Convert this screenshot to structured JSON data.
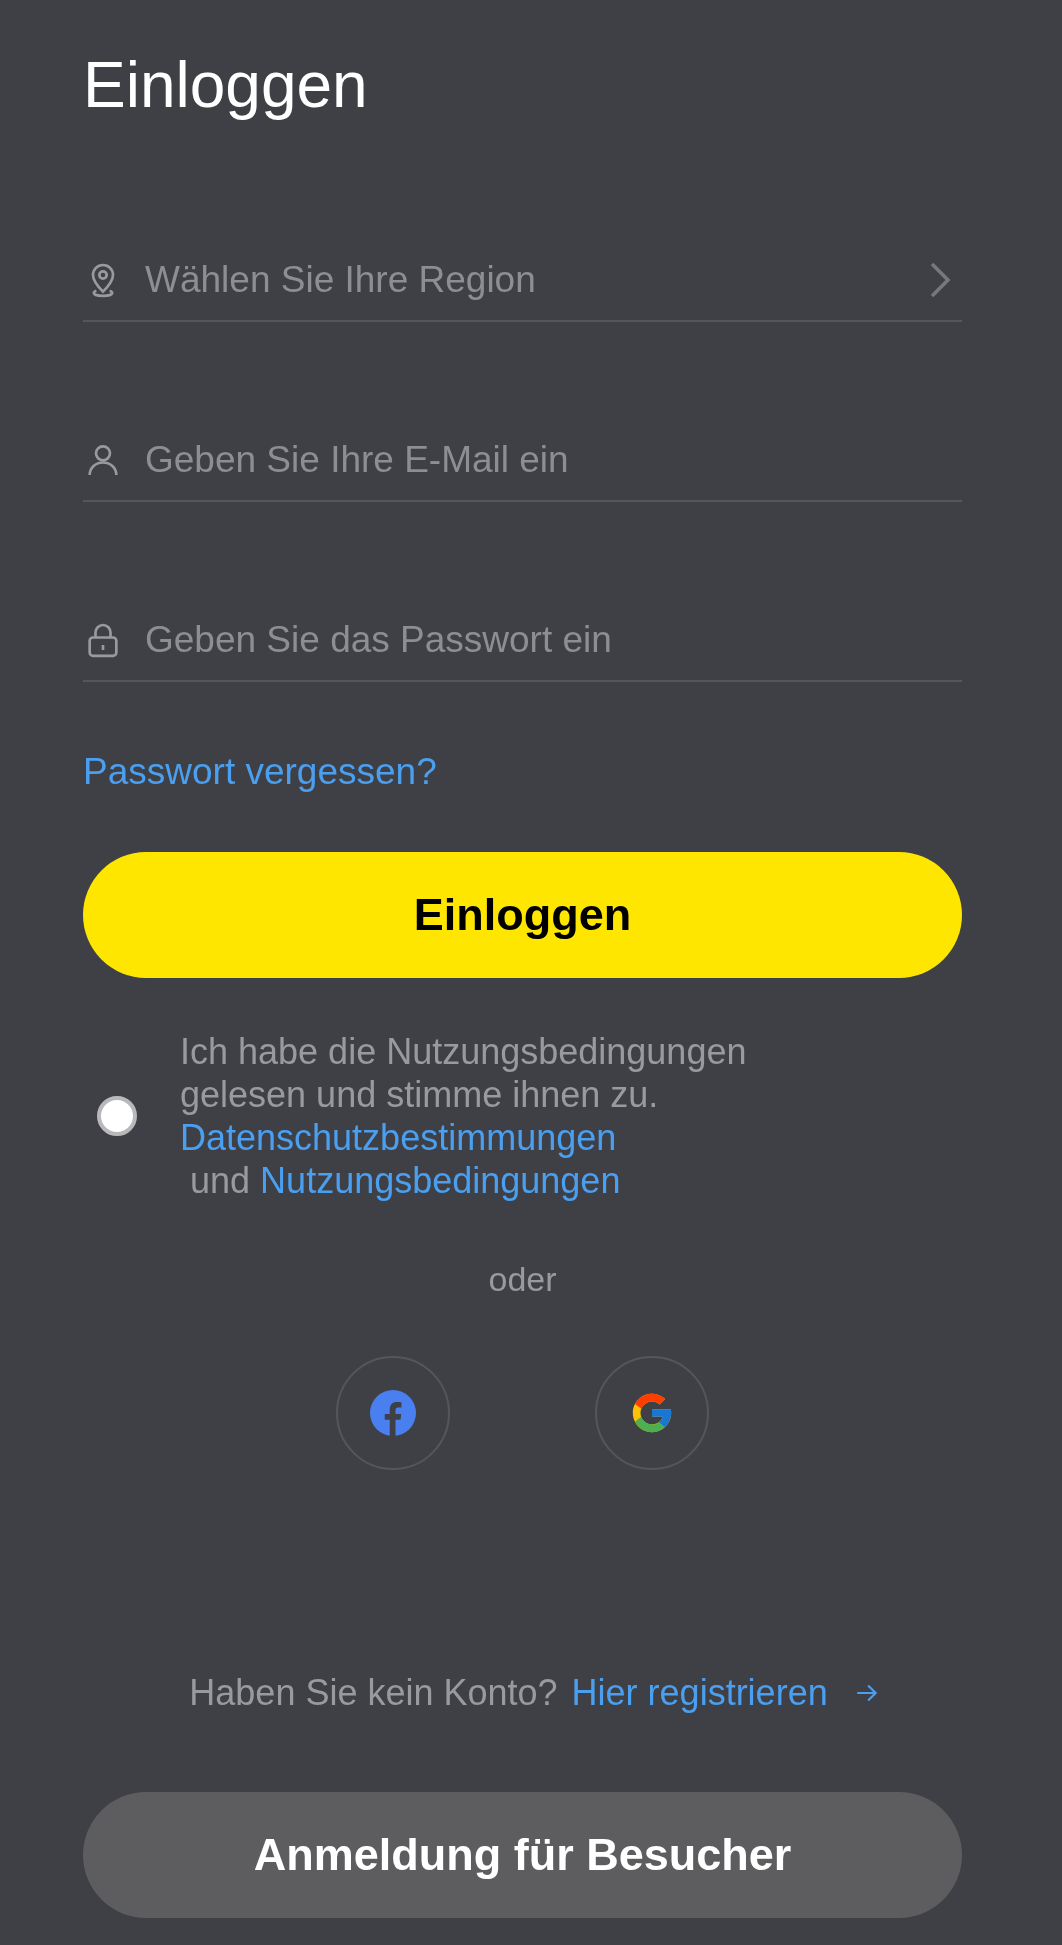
{
  "title": "Einloggen",
  "fields": [
    {
      "kind": "region",
      "placeholder": "Wählen Sie Ihre Region"
    },
    {
      "kind": "email",
      "placeholder": "Geben Sie Ihre E-Mail ein"
    },
    {
      "kind": "password",
      "placeholder": "Geben Sie das Passwort ein"
    }
  ],
  "forgot_link": "Passwort vergessen?",
  "login_button": "Einloggen",
  "terms": {
    "checked": false,
    "text_1": "Ich habe die Nutzungsbedingungen gelesen und stimme ihnen zu.",
    "link_1": "Datenschutzbestimmungen",
    "text_2": "und",
    "link_2": "Nutzungsbedingungen"
  },
  "divider_text": "oder",
  "social": [
    {
      "kind": "facebook"
    },
    {
      "kind": "google"
    }
  ],
  "register": {
    "text": "Haben Sie kein Konto?",
    "link": "Hier registrieren"
  },
  "guest_button": "Anmeldung für Besucher"
}
